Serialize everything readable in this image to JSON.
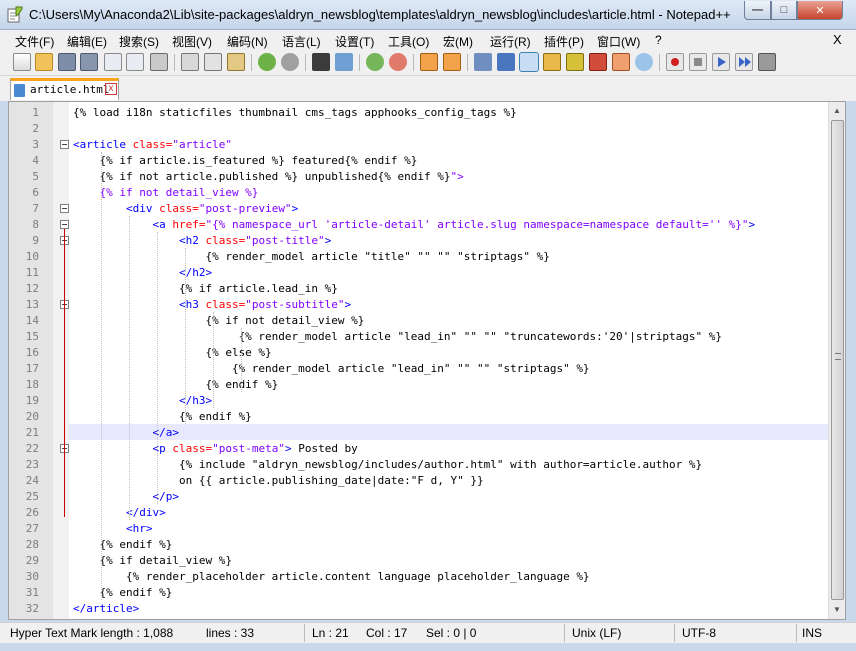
{
  "window": {
    "title": "C:\\Users\\My\\Anaconda2\\Lib\\site-packages\\aldryn_newsblog\\templates\\aldryn_newsblog\\includes\\article.html - Notepad++",
    "minimize_glyph": "—",
    "maximize_glyph": "□",
    "close_glyph": "✕"
  },
  "menu": {
    "items": [
      "文件(F)",
      "编辑(E)",
      "搜索(S)",
      "视图(V)",
      "编码(N)",
      "语言(L)",
      "设置(T)",
      "工具(O)",
      "宏(M)",
      "运行(R)",
      "插件(P)",
      "窗口(W)",
      "?"
    ],
    "close_glyph": "X"
  },
  "toolbar": {
    "icons": [
      "new-file-icon",
      "open-file-icon",
      "save-icon",
      "save-all-icon",
      "close-file-icon",
      "close-all-icon",
      "print-icon",
      "cut-icon",
      "copy-icon",
      "paste-icon",
      "undo-icon",
      "redo-icon",
      "find-icon",
      "replace-icon",
      "zoom-in-icon",
      "zoom-out-icon",
      "sync-vertical-icon",
      "sync-horizontal-icon",
      "word-wrap-icon",
      "show-all-chars-icon",
      "indent-guide-icon",
      "user-define-lang-icon",
      "doc-map-icon",
      "function-list-icon",
      "folder-workspace-icon",
      "monitor-icon",
      "record-macro-icon",
      "stop-record-icon",
      "play-macro-icon",
      "run-macro-multiple-icon",
      "save-macro-icon"
    ]
  },
  "tab": {
    "label": "article.html",
    "close_glyph": "x"
  },
  "editor": {
    "current_line": 21,
    "lines": [
      {
        "n": "1",
        "tokens": [
          {
            "t": "text",
            "v": "{% load i18n staticfiles thumbnail cms_tags apphooks_config_tags %}"
          }
        ]
      },
      {
        "n": "2",
        "tokens": []
      },
      {
        "n": "3",
        "tokens": [
          {
            "t": "tag",
            "v": "<article "
          },
          {
            "t": "attr",
            "v": "class="
          },
          {
            "t": "str",
            "v": "\"article\""
          }
        ]
      },
      {
        "n": "4",
        "tokens": [
          {
            "t": "text",
            "v": "    {% if article.is_featured %} featured{% endif %}"
          }
        ]
      },
      {
        "n": "5",
        "tokens": [
          {
            "t": "text",
            "v": "    {% if not article.published %} unpublished{% endif %}"
          },
          {
            "t": "str",
            "v": "\">"
          }
        ]
      },
      {
        "n": "6",
        "tokens": [
          {
            "t": "str",
            "v": "    {% if not detail_view %}"
          }
        ]
      },
      {
        "n": "7",
        "tokens": [
          {
            "t": "tag",
            "v": "        <div "
          },
          {
            "t": "attr",
            "v": "class="
          },
          {
            "t": "str",
            "v": "\"post-preview\""
          },
          {
            "t": "tag",
            "v": ">"
          }
        ]
      },
      {
        "n": "8",
        "tokens": [
          {
            "t": "tag",
            "v": "            <a "
          },
          {
            "t": "attr",
            "v": "href="
          },
          {
            "t": "str",
            "v": "\"{% namespace_url 'article-detail' article.slug namespace=namespace default='' %}\""
          },
          {
            "t": "tag",
            "v": ">"
          }
        ]
      },
      {
        "n": "9",
        "tokens": [
          {
            "t": "tag",
            "v": "                <h2 "
          },
          {
            "t": "attr",
            "v": "class="
          },
          {
            "t": "str",
            "v": "\"post-title\""
          },
          {
            "t": "tag",
            "v": ">"
          }
        ]
      },
      {
        "n": "10",
        "tokens": [
          {
            "t": "text",
            "v": "                    {% render_model article \"title\" \"\" \"\" \"striptags\" %}"
          }
        ]
      },
      {
        "n": "11",
        "tokens": [
          {
            "t": "tag",
            "v": "                </h2>"
          }
        ]
      },
      {
        "n": "12",
        "tokens": [
          {
            "t": "text",
            "v": "                {% if article.lead_in %}"
          }
        ]
      },
      {
        "n": "13",
        "tokens": [
          {
            "t": "tag",
            "v": "                <h3 "
          },
          {
            "t": "attr",
            "v": "class="
          },
          {
            "t": "str",
            "v": "\"post-subtitle\""
          },
          {
            "t": "tag",
            "v": ">"
          }
        ]
      },
      {
        "n": "14",
        "tokens": [
          {
            "t": "text",
            "v": "                    {% if not detail_view %}"
          }
        ]
      },
      {
        "n": "15",
        "tokens": [
          {
            "t": "text",
            "v": "                         {% render_model article \"lead_in\" \"\" \"\" \"truncatewords:'20'|striptags\" %}"
          }
        ]
      },
      {
        "n": "16",
        "tokens": [
          {
            "t": "text",
            "v": "                    {% else %}"
          }
        ]
      },
      {
        "n": "17",
        "tokens": [
          {
            "t": "text",
            "v": "                        {% render_model article \"lead_in\" \"\" \"\" \"striptags\" %}"
          }
        ]
      },
      {
        "n": "18",
        "tokens": [
          {
            "t": "text",
            "v": "                    {% endif %}"
          }
        ]
      },
      {
        "n": "19",
        "tokens": [
          {
            "t": "tag",
            "v": "                </h3>"
          }
        ]
      },
      {
        "n": "20",
        "tokens": [
          {
            "t": "text",
            "v": "                {% endif %}"
          }
        ]
      },
      {
        "n": "21",
        "tokens": [
          {
            "t": "tag",
            "v": "            </a>"
          }
        ]
      },
      {
        "n": "22",
        "tokens": [
          {
            "t": "tag",
            "v": "            <p "
          },
          {
            "t": "attr",
            "v": "class="
          },
          {
            "t": "str",
            "v": "\"post-meta\""
          },
          {
            "t": "tag",
            "v": ">"
          },
          {
            "t": "text",
            "v": " Posted by"
          }
        ]
      },
      {
        "n": "23",
        "tokens": [
          {
            "t": "text",
            "v": "                {% include \"aldryn_newsblog/includes/author.html\" with author=article.author %}"
          }
        ]
      },
      {
        "n": "24",
        "tokens": [
          {
            "t": "text",
            "v": "                on {{ article.publishing_date|date:\"F d, Y\" }}"
          }
        ]
      },
      {
        "n": "25",
        "tokens": [
          {
            "t": "tag",
            "v": "            </p>"
          }
        ]
      },
      {
        "n": "26",
        "tokens": [
          {
            "t": "tag",
            "v": "        </div>"
          }
        ]
      },
      {
        "n": "27",
        "tokens": [
          {
            "t": "tag",
            "v": "        <hr>"
          }
        ]
      },
      {
        "n": "28",
        "tokens": [
          {
            "t": "text",
            "v": "    {% endif %}"
          }
        ]
      },
      {
        "n": "29",
        "tokens": [
          {
            "t": "text",
            "v": "    {% if detail_view %}"
          }
        ]
      },
      {
        "n": "30",
        "tokens": [
          {
            "t": "text",
            "v": "        {% render_placeholder article.content language placeholder_language %}"
          }
        ]
      },
      {
        "n": "31",
        "tokens": [
          {
            "t": "text",
            "v": "    {% endif %}"
          }
        ]
      },
      {
        "n": "32",
        "tokens": [
          {
            "t": "tag",
            "v": "</article>"
          }
        ]
      }
    ],
    "fold_markers": [
      3,
      7,
      8,
      9,
      13,
      22
    ]
  },
  "status": {
    "doc_type": "Hyper Text Mark length : 1,088",
    "lines": "lines : 33",
    "ln": "Ln : 21",
    "col": "Col : 17",
    "sel": "Sel : 0 | 0",
    "eol": "Unix (LF)",
    "encoding": "UTF-8",
    "mode": "INS"
  }
}
